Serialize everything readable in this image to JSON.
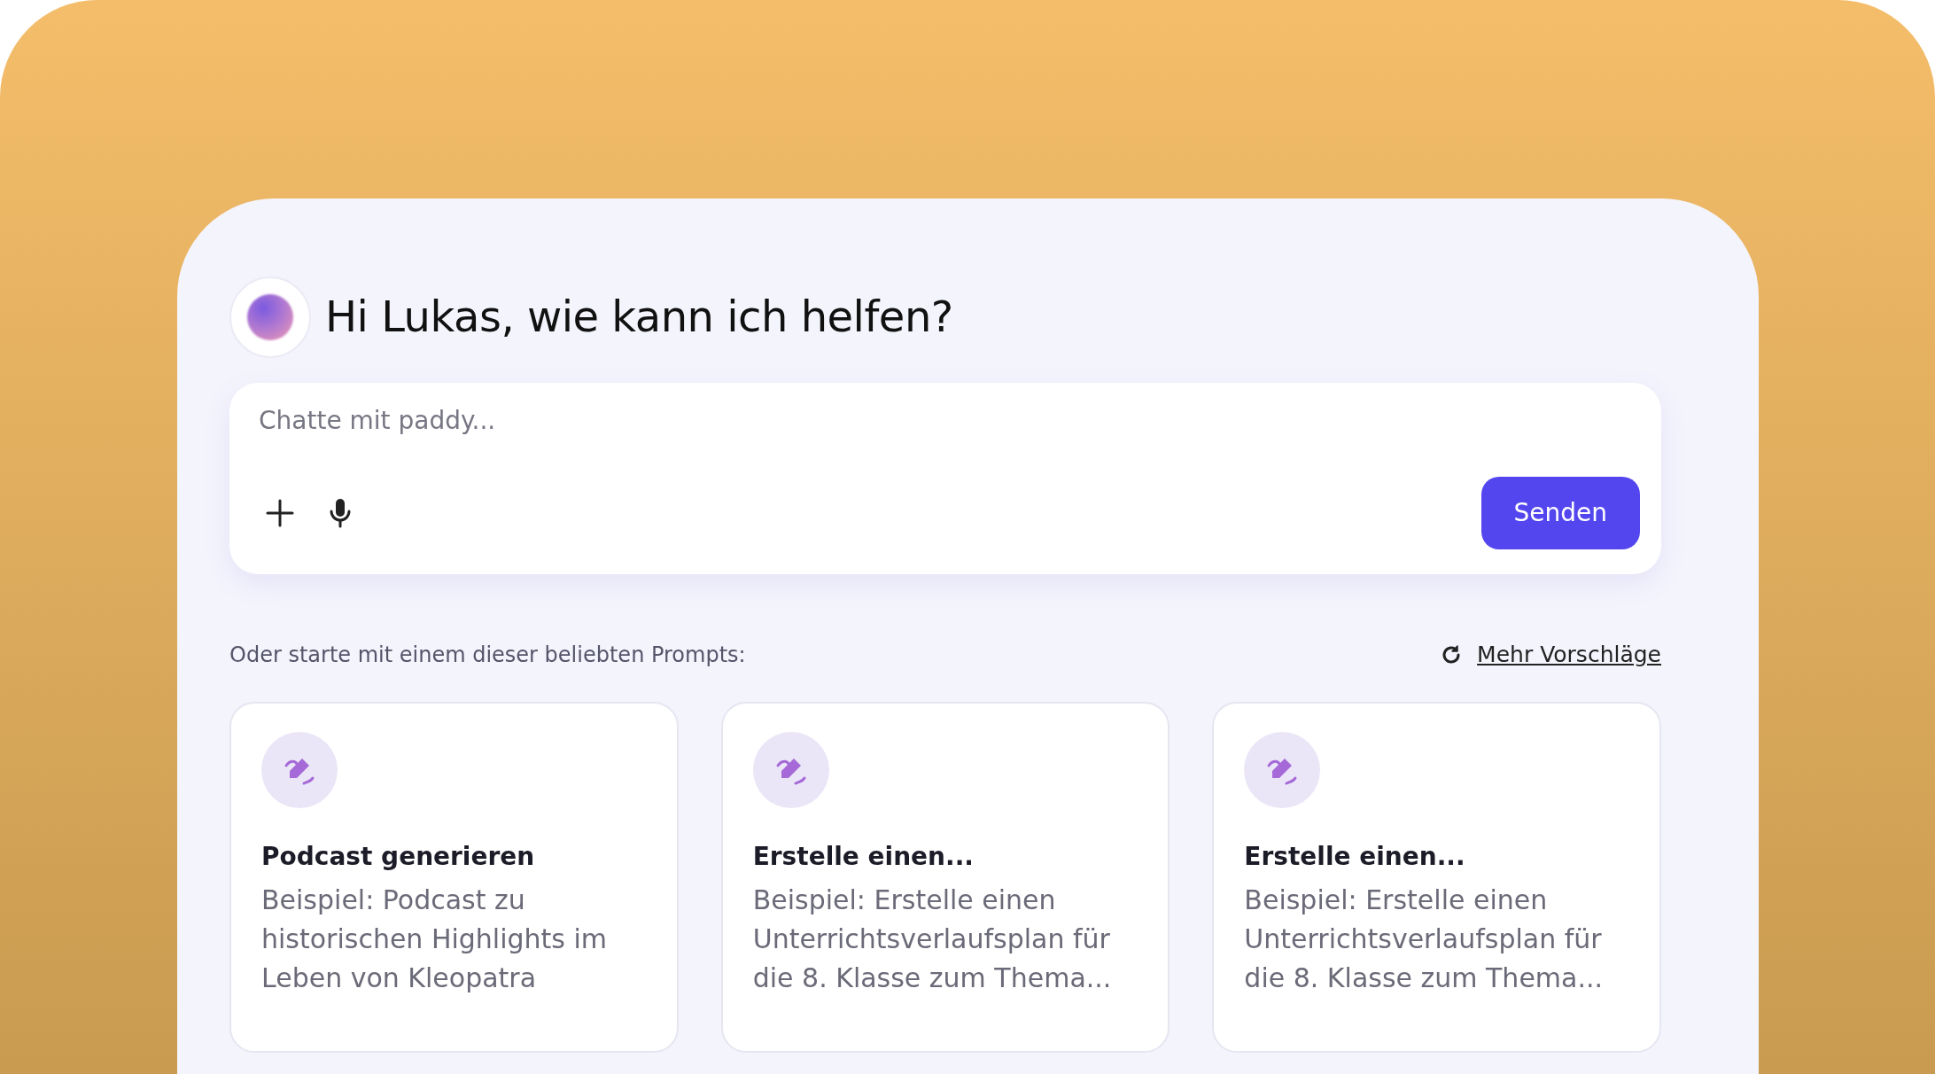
{
  "greeting": "Hi Lukas, wie kann ich helfen?",
  "chat_input": {
    "placeholder": "Chatte mit paddy..."
  },
  "send_button": "Senden",
  "prompts_intro": "Oder starte mit einem dieser beliebten Prompts:",
  "more_link": "Mehr Vorschläge",
  "prompt_cards": [
    {
      "title": "Podcast generieren",
      "description": "Beispiel: Podcast zu historischen Highlights im Leben von Kleopatra"
    },
    {
      "title": "Erstelle einen...",
      "description": "Beispiel: Erstelle einen Unterrichtsverlaufsplan für die 8. Klasse zum Thema..."
    },
    {
      "title": "Erstelle einen...",
      "description": "Beispiel: Erstelle einen Unterrichtsverlaufsplan für die 8. Klasse zum Thema..."
    }
  ]
}
